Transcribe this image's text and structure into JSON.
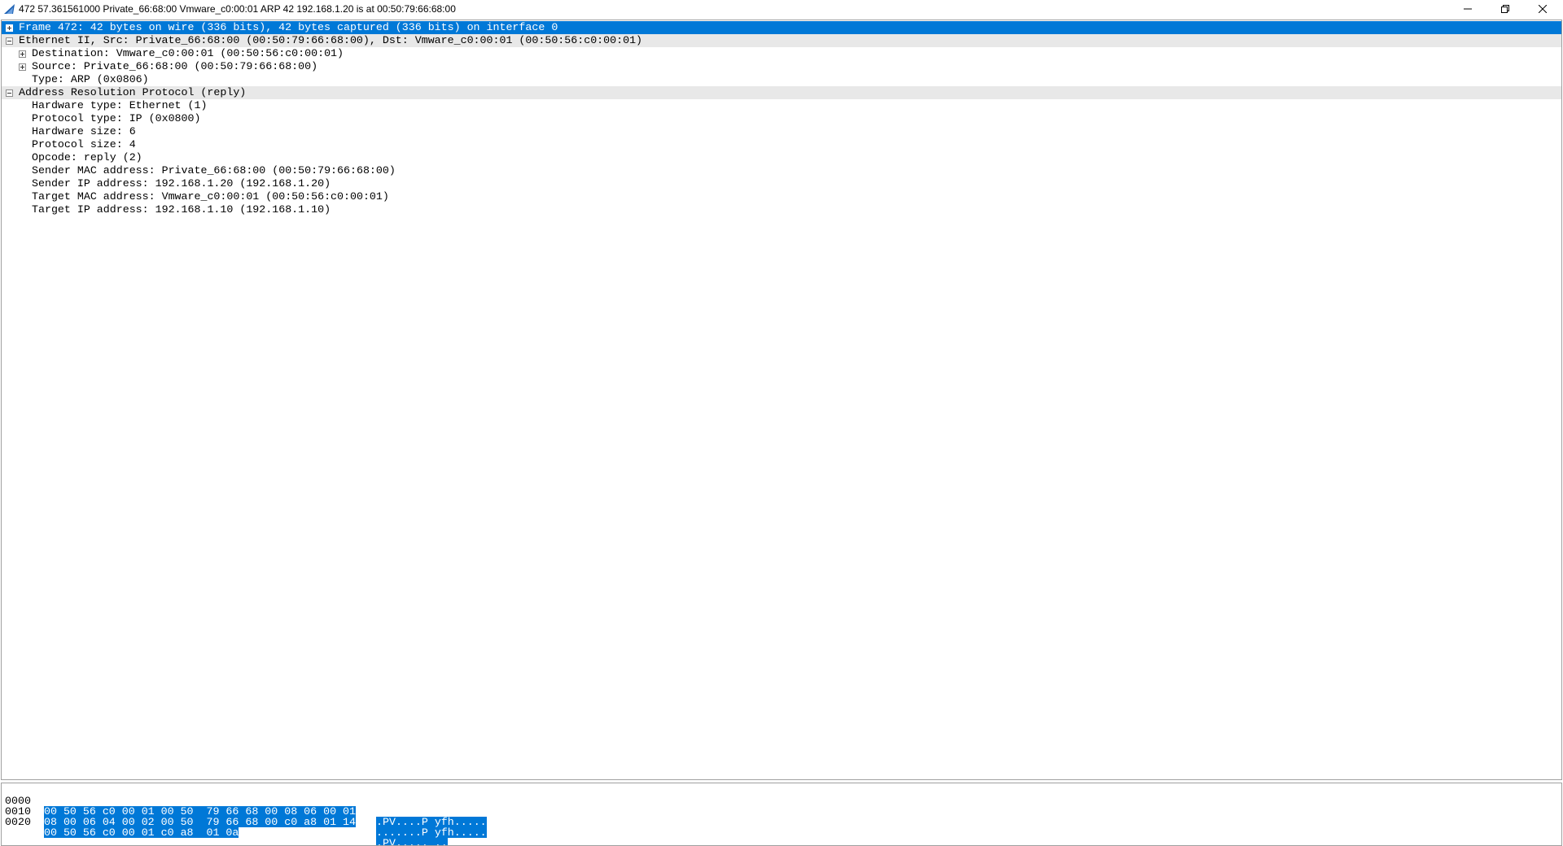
{
  "window": {
    "title": "472 57.361561000 Private_66:68:00 Vmware_c0:00:01 ARP 42 192.168.1.20 is at 00:50:79:66:68:00"
  },
  "details": {
    "frame": "Frame 472: 42 bytes on wire (336 bits), 42 bytes captured (336 bits) on interface 0",
    "ethernet": "Ethernet II, Src: Private_66:68:00 (00:50:79:66:68:00), Dst: Vmware_c0:00:01 (00:50:56:c0:00:01)",
    "eth_destination": "Destination: Vmware_c0:00:01 (00:50:56:c0:00:01)",
    "eth_source": "Source: Private_66:68:00 (00:50:79:66:68:00)",
    "eth_type": "Type: ARP (0x0806)",
    "arp": "Address Resolution Protocol (reply)",
    "arp_fields": [
      "Hardware type: Ethernet (1)",
      "Protocol type: IP (0x0800)",
      "Hardware size: 6",
      "Protocol size: 4",
      "Opcode: reply (2)",
      "Sender MAC address: Private_66:68:00 (00:50:79:66:68:00)",
      "Sender IP address: 192.168.1.20 (192.168.1.20)",
      "Target MAC address: Vmware_c0:00:01 (00:50:56:c0:00:01)",
      "Target IP address: 192.168.1.10 (192.168.1.10)"
    ]
  },
  "bytes": [
    {
      "offset": "0000",
      "hex": "00 50 56 c0 00 01 00 50  79 66 68 00 08 06 00 01",
      "ascii": ".PV....P yfh....."
    },
    {
      "offset": "0010",
      "hex": "08 00 06 04 00 02 00 50  79 66 68 00 c0 a8 01 14",
      "ascii": ".......P yfh....."
    },
    {
      "offset": "0020",
      "hex": "00 50 56 c0 00 01 c0 a8  01 0a",
      "ascii": ".PV..... .."
    }
  ],
  "colors": {
    "selection": "#0078d7",
    "section_header": "#e8e8e8"
  }
}
